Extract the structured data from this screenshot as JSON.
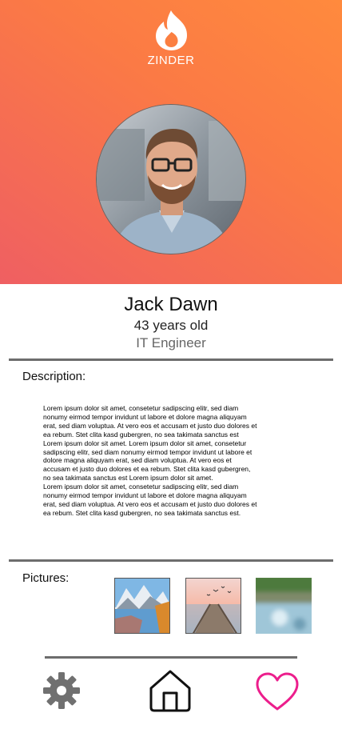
{
  "header": {
    "brand_name": "ZINDER",
    "logo_icon": "flame-icon",
    "gradient_colors": [
      "#ff8a3d",
      "#ef5f62"
    ]
  },
  "profile": {
    "avatar_icon": "profile-photo",
    "name": "Jack Dawn",
    "age": "43 years old",
    "occupation": "IT Engineer"
  },
  "description": {
    "label": "Description:",
    "text": "Lorem ipsum dolor sit amet, consetetur sadipscing elitr, sed diam\nnonumy eirmod tempor invidunt ut labore et dolore magna aliquyam\nerat, sed diam voluptua. At vero eos et accusam et justo duo dolores et\nea rebum. Stet clita kasd gubergren, no sea takimata sanctus est\nLorem ipsum dolor sit amet. Lorem ipsum dolor sit amet, consetetur\nsadipscing elitr, sed diam nonumy eirmod tempor invidunt ut labore et\ndolore magna aliquyam erat, sed diam voluptua. At vero eos et\naccusam et justo duo dolores et ea rebum. Stet clita kasd gubergren,\nno sea takimata sanctus est Lorem ipsum dolor sit amet.\nLorem ipsum dolor sit amet, consetetur sadipscing elitr, sed diam\nnonumy eirmod tempor invidunt ut labore et dolore magna aliquyam\nerat, sed diam voluptua. At vero eos et accusam et justo duo dolores et\nea rebum. Stet clita kasd gubergren, no sea takimata sanctus est."
  },
  "pictures": {
    "label": "Pictures:",
    "items": [
      "mountain-lake-thumbnail",
      "boardwalk-sunset-thumbnail",
      "blurred-thumbnail"
    ]
  },
  "bottom_nav": {
    "items": [
      "settings-gear-icon",
      "home-icon",
      "heart-icon"
    ],
    "accent_color": "#ec1e8c"
  }
}
